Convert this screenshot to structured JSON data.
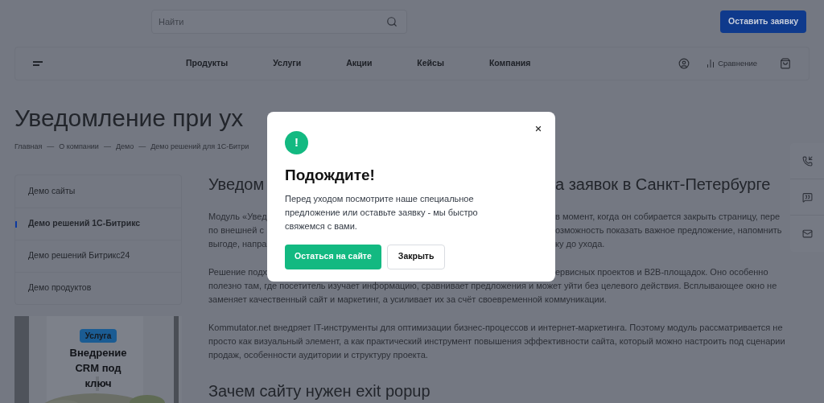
{
  "header": {
    "search": {
      "placeholder": "Найти"
    },
    "cta": "Оставить заявку"
  },
  "nav": {
    "items": [
      "Продукты",
      "Услуги",
      "Акции",
      "Кейсы",
      "Компания"
    ],
    "compare": "Сравнение"
  },
  "page_title": "Уведомление при ух",
  "breadcrumbs": [
    "Главная",
    "О компании",
    "Демо",
    "Демо решений для 1С-Битри"
  ],
  "breadcrumb_separator": "—",
  "sidebar": {
    "items": [
      {
        "label": "Демо сайты",
        "selected": false
      },
      {
        "label": "Демо решений 1С-Битрикс",
        "selected": true
      },
      {
        "label": "Демо решений Битрикс24",
        "selected": false
      },
      {
        "label": "Демо продуктов",
        "selected": false
      }
    ]
  },
  "promo": {
    "kind": "picture",
    "badge": "Услуга",
    "title": "Внедрение CRM под ключ"
  },
  "article": {
    "heading": {
      "left": "Уведом",
      "right": "а заявок в Санкт-Петербурге"
    },
    "paragraphs": [
      [
        {
          "left": "Модуль «Увед",
          "right": "в момент, когда он собирается закрыть страницу, пере"
        },
        {
          "left": "по внешней с",
          "right": "озможность показать важное предложение, напомнить"
        },
        {
          "left": "выгоде, напра",
          "right": "ку до ухода."
        }
      ],
      [
        {
          "left": "Решение подх",
          "right": "ервисных проектов и B2B-площадок. Оно особенно"
        },
        {
          "left": "полезно там, где посетитель изучает информацию, сравнивает предложения и может уйти без целевого действия. Всплывающее окно не"
        },
        {
          "left": "заменяет качественный сайт и маркетинг, а усиливает их за счёт своевременной коммуникации."
        }
      ],
      [
        {
          "left": "Kommutator.net внедряет IT-инструменты для оптимизации бизнес-процессов и интернет-маркетинга. Поэтому модуль рассматривается не"
        },
        {
          "left": "просто как визуальный элемент, а как практический инструмент повышения эффективности сайта, который можно настроить под сценарии"
        },
        {
          "left": "продаж, особенности аудитории и структуру проекта."
        }
      ]
    ],
    "subheading": "Зачем сайту нужен exit popup"
  },
  "modal": {
    "icon": "!",
    "title": "Подождите!",
    "text": "Перед уходом посмотрите наше специальное предложение или оставьте заявку - мы быстро свяжемся с вами.",
    "primary": "Остаться на сайте",
    "secondary": "Закрыть"
  }
}
